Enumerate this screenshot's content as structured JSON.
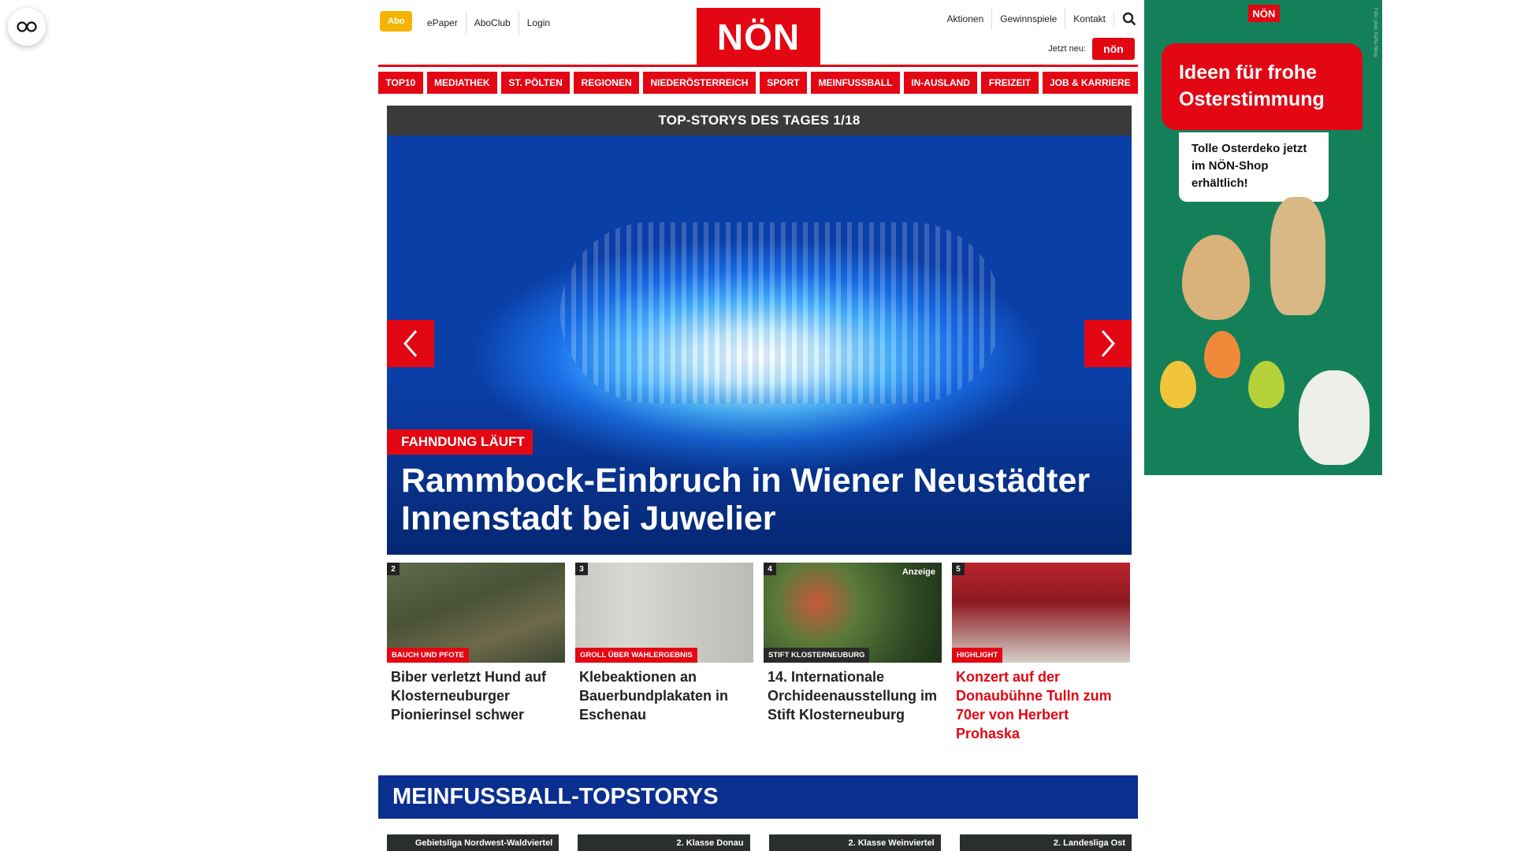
{
  "header": {
    "abo_label": "Abo",
    "top_links": [
      "ePaper",
      "AboClub",
      "Login"
    ],
    "logo": "NÖN",
    "right_links": [
      "Aktionen",
      "Gewinnspiele",
      "Kontakt"
    ],
    "jetzt_label": "Jetzt neu:",
    "jetzt_logo": "nön"
  },
  "nav": {
    "items": [
      "TOP10",
      "MEDIATHEK",
      "ST. PÖLTEN",
      "REGIONEN",
      "NIEDERÖSTERREICH",
      "SPORT",
      "MEINFUSSBALL",
      "IN-AUSLAND",
      "FREIZEIT",
      "JOB & KARRIERE"
    ]
  },
  "carousel": {
    "heading": "TOP-STORYS DES TAGES 1/18",
    "kicker": "FAHNDUNG LÄUFT",
    "title": "Rammbock-Einbruch in Wiener Neustädter Innenstadt bei Juwelier"
  },
  "teasers": [
    {
      "num": "2",
      "tag": "BAUCH UND PFOTE",
      "title": "Biber verletzt Hund auf Klosterneuburger Pionierinsel schwer",
      "ad": ""
    },
    {
      "num": "3",
      "tag": "GROLL ÜBER WAHLERGEBNIS",
      "title": "Klebeaktionen an Bauerbundplakaten in Eschenau",
      "ad": ""
    },
    {
      "num": "4",
      "tag": "STIFT KLOSTERNEUBURG",
      "title": "14. Internationale Orchideenausstellung im Stift Klosterneuburg",
      "ad": "Anzeige"
    },
    {
      "num": "5",
      "tag": "HIGHLIGHT",
      "title": "Konzert auf der Donaubühne Tulln zum 70er von Herbert Prohaska",
      "ad": ""
    }
  ],
  "section": {
    "title": "MEINFUSSBALL-TOPSTORYS",
    "items": [
      "Gebietsliga Nordwest-Waldviertel",
      "2. Klasse Donau",
      "2. Klasse Weinviertel",
      "2. Landesliga Ost"
    ]
  },
  "ad": {
    "logo": "NÖN",
    "headline": "Ideen für frohe Osterstimmung",
    "sub": "Tolle Osterdeko jetzt im NÖN-Shop erhältlich!",
    "side_text": "Foto: pixel, KaRa-Shop"
  },
  "colors": {
    "brand_red": "#e30613",
    "section_blue": "#0a2f8f",
    "abo_yellow": "#f5b400",
    "ad_green": "#14805a"
  }
}
